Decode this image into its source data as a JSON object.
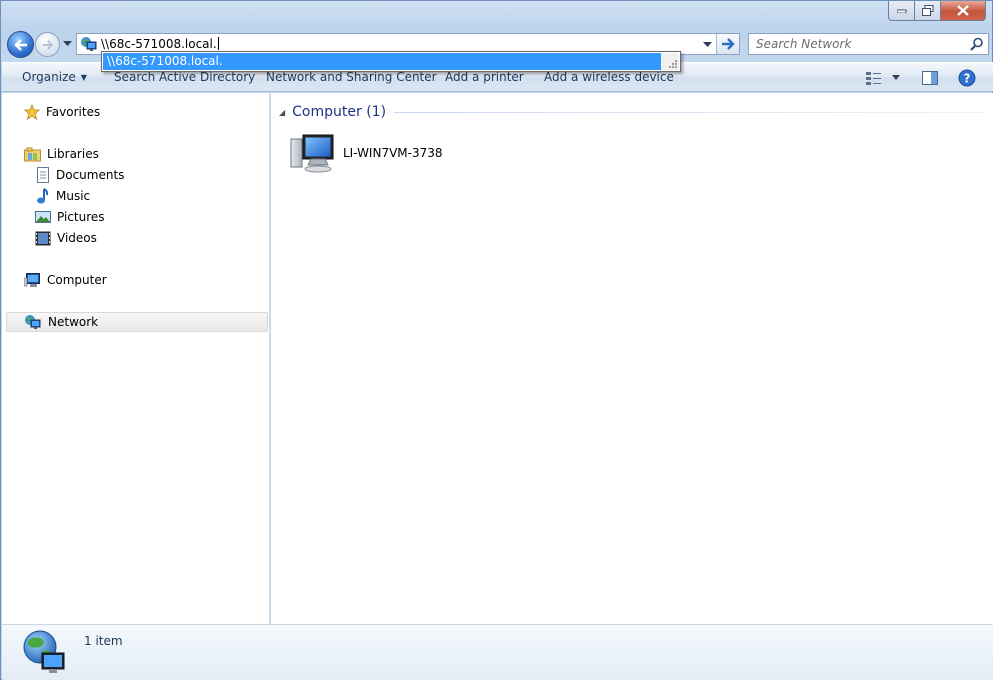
{
  "window": {
    "controls": [
      "minimize",
      "maximize",
      "close"
    ]
  },
  "navigation": {
    "back_icon": "back-arrow-icon",
    "forward_icon": "forward-arrow-icon",
    "address_value": "\\\\68c-571008.local.",
    "address_icon": "network-icon",
    "search_placeholder": "Search Network"
  },
  "autocomplete": {
    "suggestion": "\\\\68c-571008.local."
  },
  "toolbar": {
    "organize": "Organize",
    "search_ad": "Search Active Directory",
    "network_sharing": "Network and Sharing Center",
    "add_printer": "Add a printer",
    "add_wireless": "Add a wireless device"
  },
  "sidebar": {
    "favorites": "Favorites",
    "libraries": "Libraries",
    "documents": "Documents",
    "music": "Music",
    "pictures": "Pictures",
    "videos": "Videos",
    "computer": "Computer",
    "network": "Network",
    "selected": "Network"
  },
  "content": {
    "group_title": "Computer (1)",
    "items": [
      {
        "name": "LI-WIN7VM-3738",
        "icon": "computer-icon"
      }
    ]
  },
  "status": {
    "count": "1 item",
    "icon": "network-globe-icon"
  },
  "colors": {
    "accent": "#3399ff",
    "group_title": "#1e3287",
    "command_text": "#1e395b"
  }
}
